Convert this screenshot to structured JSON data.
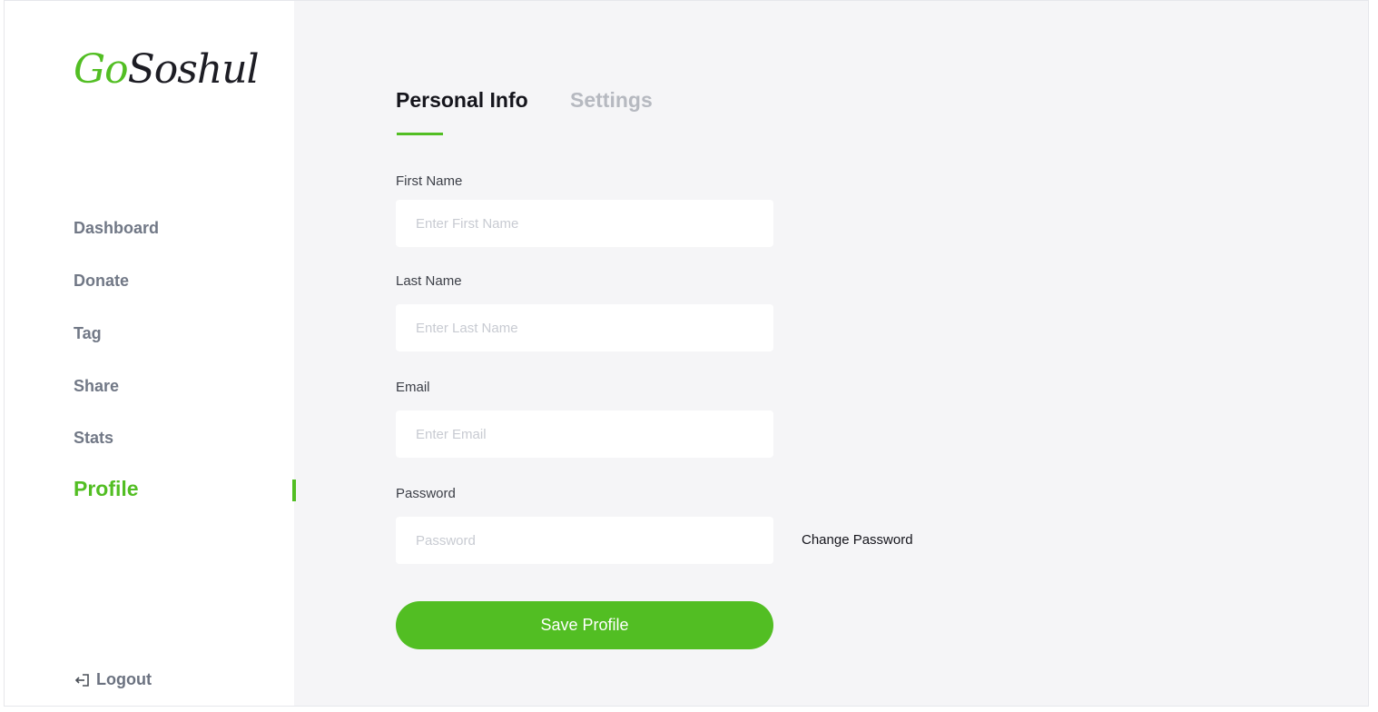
{
  "brand": {
    "logo_go": "Go",
    "logo_rest": "Soshul",
    "accent_color": "#52be23"
  },
  "sidebar": {
    "items": [
      {
        "label": "Dashboard"
      },
      {
        "label": "Donate"
      },
      {
        "label": "Tag"
      },
      {
        "label": "Share"
      },
      {
        "label": "Stats"
      },
      {
        "label": "Profile",
        "active": true
      }
    ],
    "logout_label": "Logout",
    "logout_icon": "logout-icon"
  },
  "tabs": [
    {
      "label": "Personal Info",
      "active": true
    },
    {
      "label": "Settings",
      "active": false
    }
  ],
  "form": {
    "first_name": {
      "label": "First Name",
      "placeholder": "Enter First Name",
      "value": ""
    },
    "last_name": {
      "label": "Last Name",
      "placeholder": "Enter Last Name",
      "value": ""
    },
    "email": {
      "label": "Email",
      "placeholder": "Enter Email",
      "value": ""
    },
    "password": {
      "label": "Password",
      "placeholder": "Password",
      "value": ""
    },
    "change_password_label": "Change Password",
    "save_label": "Save Profile"
  }
}
